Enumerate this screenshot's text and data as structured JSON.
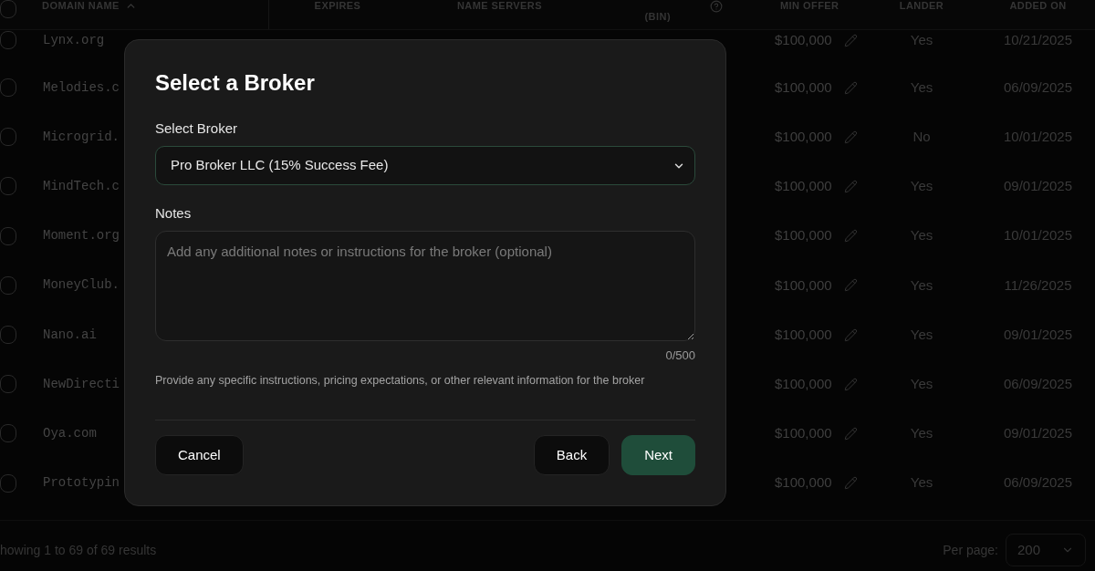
{
  "table": {
    "select_all": {
      "checked": false
    },
    "columns": [
      {
        "label": "DOMAIN NAME",
        "sorted_ascending": true
      },
      {
        "label": "EXPIRES"
      },
      {
        "label": "NAME SERVERS"
      },
      {
        "label": "(BIN)",
        "help": true
      },
      {
        "label": "MIN OFFER"
      },
      {
        "label": "LANDER"
      },
      {
        "label": "ADDED ON"
      }
    ],
    "rows": [
      {
        "checked": false,
        "domain": "Lynx.org",
        "min_offer": "$100,000",
        "lander": "Yes",
        "added_on": "10/21/2025"
      },
      {
        "checked": false,
        "domain": "Melodies.c",
        "min_offer": "$100,000",
        "lander": "Yes",
        "added_on": "06/09/2025"
      },
      {
        "checked": false,
        "domain": "Microgrid.",
        "min_offer": "$100,000",
        "lander": "No",
        "added_on": "10/01/2025"
      },
      {
        "checked": false,
        "domain": "MindTech.c",
        "min_offer": "$100,000",
        "lander": "Yes",
        "added_on": "09/01/2025"
      },
      {
        "checked": false,
        "domain": "Moment.org",
        "min_offer": "$100,000",
        "lander": "Yes",
        "added_on": "10/01/2025"
      },
      {
        "checked": false,
        "domain": "MoneyClub.",
        "min_offer": "$100,000",
        "lander": "Yes",
        "added_on": "11/26/2025"
      },
      {
        "checked": false,
        "domain": "Nano.ai",
        "min_offer": "$100,000",
        "lander": "Yes",
        "added_on": "09/01/2025"
      },
      {
        "checked": false,
        "domain": "NewDirecti",
        "min_offer": "$100,000",
        "lander": "Yes",
        "added_on": "06/09/2025"
      },
      {
        "checked": false,
        "domain": "Oya.com",
        "min_offer": "$100,000",
        "lander": "Yes",
        "added_on": "09/01/2025"
      },
      {
        "checked": false,
        "domain": "Prototypin",
        "min_offer": "$100,000",
        "lander": "Yes",
        "added_on": "06/09/2025"
      }
    ]
  },
  "footer": {
    "summary": "howing 1 to 69 of 69 results",
    "per_page_label": "Per page:",
    "per_page": "200"
  },
  "dialog": {
    "title": "Select a Broker",
    "broker": {
      "label": "Select Broker",
      "value": "Pro Broker LLC (15% Success Fee)",
      "focused": true
    },
    "notes": {
      "label": "Notes",
      "placeholder": "Add any additional notes or instructions for the broker (optional)",
      "counter": "0/500",
      "hint": "Provide any specific instructions, pricing expectations, or other relevant information for the broker"
    },
    "actions_left": [
      {
        "label": "Cancel",
        "kind": "secondary"
      }
    ],
    "actions_right": [
      {
        "label": "Back",
        "kind": "secondary"
      },
      {
        "label": "Next",
        "kind": "primary"
      }
    ]
  }
}
